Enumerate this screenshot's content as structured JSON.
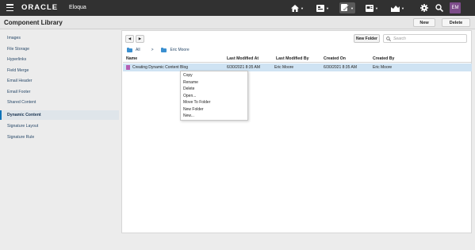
{
  "topbar": {
    "brand": "ORACLE",
    "product": "Eloqua",
    "user_initials": "EM",
    "icons": [
      "menu-icon",
      "home-icon",
      "assets-icon",
      "components-icon",
      "campaigns-icon",
      "reports-icon",
      "settings-icon",
      "search-icon"
    ]
  },
  "header": {
    "title": "Component Library",
    "new_label": "New",
    "delete_label": "Delete"
  },
  "sidebar": {
    "items": [
      {
        "label": "Images"
      },
      {
        "label": "File Storage"
      },
      {
        "label": "Hyperlinks"
      },
      {
        "label": "Field Merge"
      },
      {
        "label": "Email Header"
      },
      {
        "label": "Email Footer"
      },
      {
        "label": "Shared Content"
      },
      {
        "label": "Dynamic Content"
      },
      {
        "label": "Signature Layout"
      },
      {
        "label": "Signature Rule"
      }
    ],
    "active": "Dynamic Content"
  },
  "toolbar": {
    "back_label": "◀",
    "forward_label": "▶",
    "new_folder_label": "New Folder",
    "search_placeholder": "Search"
  },
  "breadcrumb": {
    "root": "All",
    "separator": ">",
    "current": "Eric Moore"
  },
  "table": {
    "columns": [
      "Name",
      "Last Modified At",
      "Last Modified By",
      "Created On",
      "Created By"
    ],
    "rows": [
      {
        "name": "Creating Dynamic Content Blog",
        "last_modified_at": "6/30/2021 8:35 AM",
        "last_modified_by": "Eric Moore",
        "created_on": "6/30/2021 8:35 AM",
        "created_by": "Eric Moore"
      }
    ]
  },
  "context_menu": {
    "items": [
      "Copy",
      "Rename",
      "Delete",
      "Open...",
      "Move To Folder",
      "New Folder",
      "New..."
    ]
  },
  "colors": {
    "topbar_bg": "#313131",
    "selected_row": "#cfe3f3",
    "active_accent": "#0c72b8",
    "avatar_bg": "#7d4c8a"
  }
}
